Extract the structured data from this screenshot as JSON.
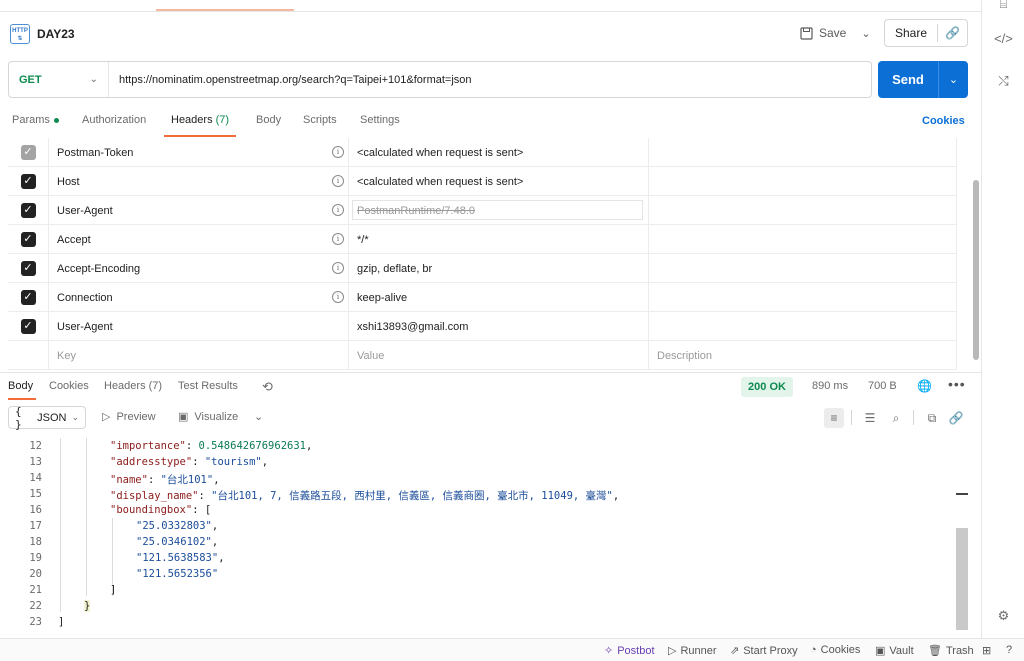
{
  "request": {
    "title": "DAY23",
    "save_label": "Save",
    "share_label": "Share",
    "method": "GET",
    "url": "https://nominatim.openstreetmap.org/search?q=Taipei+101&format=json",
    "send_label": "Send"
  },
  "request_tabs": {
    "params": "Params",
    "authorization": "Authorization",
    "headers": "Headers",
    "headers_count": "(7)",
    "body": "Body",
    "scripts": "Scripts",
    "settings": "Settings",
    "cookies": "Cookies"
  },
  "headers": {
    "rows": [
      {
        "key": "Postman-Token",
        "value": "<calculated when request is sent>",
        "checked": "dim"
      },
      {
        "key": "Host",
        "value": "<calculated when request is sent>",
        "checked": "yes"
      },
      {
        "key": "User-Agent",
        "value": "PostmanRuntime/7.48.0",
        "checked": "yes"
      },
      {
        "key": "Accept",
        "value": "*/*",
        "checked": "yes"
      },
      {
        "key": "Accept-Encoding",
        "value": "gzip, deflate, br",
        "checked": "yes"
      },
      {
        "key": "Connection",
        "value": "keep-alive",
        "checked": "yes"
      },
      {
        "key": "User-Agent",
        "value": "xshi13893@gmail.com",
        "checked": "yes"
      }
    ],
    "placeholders": {
      "key": "Key",
      "value": "Value",
      "description": "Description"
    }
  },
  "response_tabs": {
    "body": "Body",
    "cookies": "Cookies",
    "headers": "Headers",
    "headers_count": "(7)",
    "test_results": "Test Results",
    "status": "200 OK",
    "time": "890 ms",
    "size": "700 B"
  },
  "response_toolbar": {
    "format": "JSON",
    "preview": "Preview",
    "visualize": "Visualize"
  },
  "code": {
    "lines": [
      {
        "n": "12",
        "key": "\"importance\"",
        "sep": ": ",
        "val": "0.548642676962631",
        "type": "num",
        "tail": ","
      },
      {
        "n": "13",
        "key": "\"addresstype\"",
        "sep": ": ",
        "val": "\"tourism\"",
        "type": "str",
        "tail": ","
      },
      {
        "n": "14",
        "key": "\"name\"",
        "sep": ": ",
        "val": "\"台北101\"",
        "type": "str",
        "tail": ","
      },
      {
        "n": "15",
        "key": "\"display_name\"",
        "sep": ": ",
        "val": "\"台北101, 7, 信義路五段, 西村里, 信義區, 信義商圈, 臺北市, 11049, 臺灣\"",
        "type": "str",
        "tail": ","
      },
      {
        "n": "16",
        "key": "\"boundingbox\"",
        "sep": ": ",
        "val": "[",
        "type": "punc",
        "tail": ""
      },
      {
        "n": "17",
        "key": "",
        "sep": "",
        "val": "\"25.0332803\"",
        "type": "str",
        "tail": ","
      },
      {
        "n": "18",
        "key": "",
        "sep": "",
        "val": "\"25.0346102\"",
        "type": "str",
        "tail": ","
      },
      {
        "n": "19",
        "key": "",
        "sep": "",
        "val": "\"121.5638583\"",
        "type": "str",
        "tail": ","
      },
      {
        "n": "20",
        "key": "",
        "sep": "",
        "val": "\"121.5652356\"",
        "type": "str",
        "tail": ""
      },
      {
        "n": "21",
        "key": "",
        "sep": "",
        "val": "]",
        "type": "punc",
        "tail": ""
      },
      {
        "n": "22",
        "key": "",
        "sep": "",
        "val": "}",
        "type": "punc",
        "tail": ""
      },
      {
        "n": "23",
        "key": "",
        "sep": "",
        "val": "]",
        "type": "punc",
        "tail": ""
      }
    ]
  },
  "status_bar": {
    "postbot": "Postbot",
    "runner": "Runner",
    "start_proxy": "Start Proxy",
    "cookies": "Cookies",
    "vault": "Vault",
    "trash": "Trash"
  },
  "colors": {
    "accent": "#f26b3a",
    "send": "#0b6fd6",
    "method_get": "#0d8a4f",
    "status_ok_bg": "#e3f4ea",
    "json_key": "#8c1b1b",
    "json_string": "#1b4d9a",
    "json_number": "#0a7a57"
  }
}
